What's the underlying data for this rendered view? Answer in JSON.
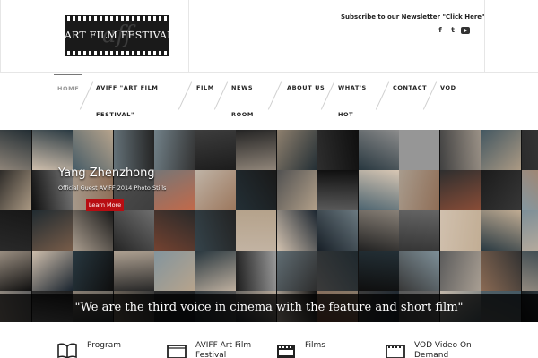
{
  "brand": {
    "logo_text": "ART FILM FESTIVAL",
    "logo_monogram": "aff"
  },
  "header": {
    "newsletter": "Subscribe to our Newsletter \"Click Here\"",
    "social": [
      {
        "icon": "facebook-icon",
        "glyph": "f"
      },
      {
        "icon": "twitter-icon",
        "glyph": "t"
      },
      {
        "icon": "youtube-icon",
        "glyph": "▶"
      }
    ]
  },
  "nav": {
    "items": [
      {
        "line1": "HOME",
        "line2": "",
        "active": true
      },
      {
        "line1": "AVIFF \"ART FILM",
        "line2": "FESTIVAL\"",
        "active": false
      },
      {
        "line1": "FILM",
        "line2": "",
        "active": false
      },
      {
        "line1": "NEWS",
        "line2": "ROOM",
        "active": false
      },
      {
        "line1": "ABOUT US",
        "line2": "",
        "active": false
      },
      {
        "line1": "WHAT'S",
        "line2": "HOT",
        "active": false
      },
      {
        "line1": "CONTACT",
        "line2": "",
        "active": false
      },
      {
        "line1": "VOD",
        "line2": "",
        "active": false
      }
    ]
  },
  "hero": {
    "title": "Yang Zhenzhong",
    "subtitle": "Official Guest AVIFF 2014 Photo Stills",
    "button": "Learn More",
    "quote": "\"We are the third voice in cinema with the feature and short film\""
  },
  "features": [
    {
      "icon": "book-icon",
      "line1": "Program",
      "line2": ""
    },
    {
      "icon": "screen-icon",
      "line1": "AVIFF Art Film",
      "line2": "Festival"
    },
    {
      "icon": "film-icon",
      "line1": "Films",
      "line2": ""
    },
    {
      "icon": "film-reel-icon",
      "line1": "VOD Video On",
      "line2": "Demand"
    }
  ],
  "colors": {
    "accent": "#b80d12",
    "text": "#222222",
    "hero_bg": "#111111"
  }
}
